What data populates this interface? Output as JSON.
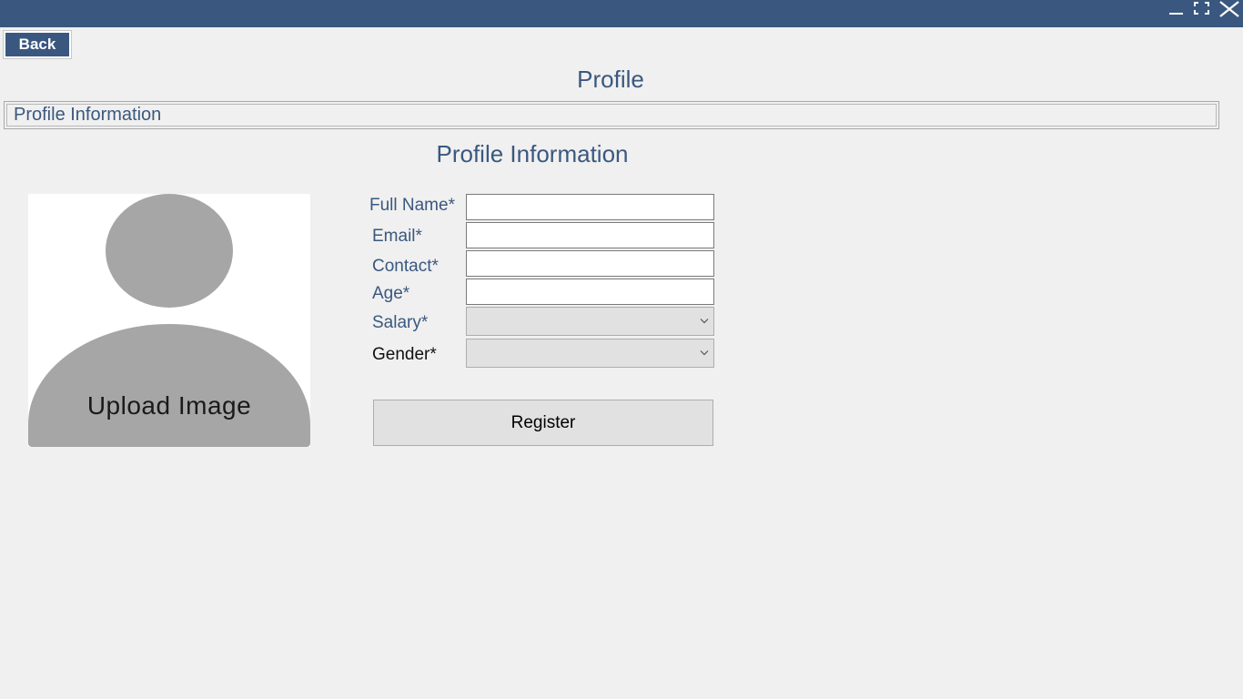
{
  "window": {
    "controls": [
      "minimize-icon",
      "maximize-icon",
      "close-icon"
    ]
  },
  "toolbar": {
    "back_label": "Back"
  },
  "page": {
    "title": "Profile"
  },
  "section": {
    "label": "Profile Information"
  },
  "form": {
    "title": "Profile Information",
    "avatar_label": "Upload Image",
    "fields": {
      "full_name": {
        "label": "Full Name*",
        "value": ""
      },
      "email": {
        "label": "Email*",
        "value": ""
      },
      "contact": {
        "label": "Contact*",
        "value": ""
      },
      "age": {
        "label": "Age*",
        "value": ""
      },
      "salary": {
        "label": "Salary*",
        "selected": ""
      },
      "gender": {
        "label": "Gender*",
        "selected": ""
      }
    },
    "register_label": "Register"
  },
  "colors": {
    "accent": "#3a587f",
    "background": "#f0f0f0",
    "avatar_gray": "#a6a6a6"
  }
}
